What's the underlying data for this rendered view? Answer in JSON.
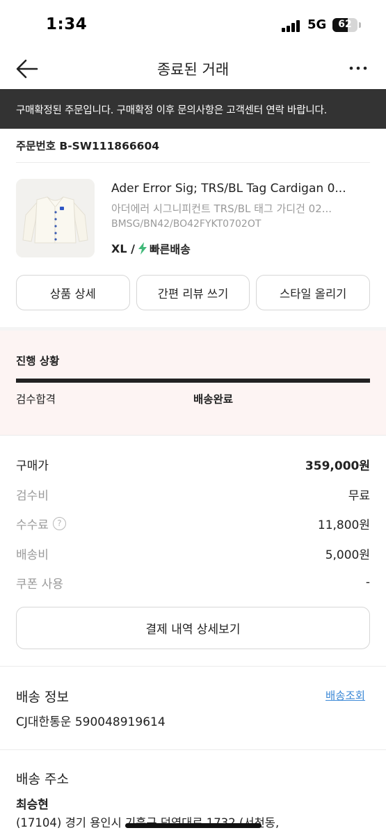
{
  "status_bar": {
    "time": "1:34",
    "network": "5G",
    "battery_level": "62"
  },
  "header": {
    "title": "종료된 거래",
    "back_icon": "arrow-left-icon",
    "more_icon": "more-dots-icon"
  },
  "notice": {
    "text": "구매확정된 주문입니다. 구매확정 이후 문의사항은 고객센터 연락 바랍니다."
  },
  "order": {
    "number_label": "주문번호 B-SW111866604"
  },
  "product": {
    "name_en": "Ader Error Sig; TRS/BL Tag Cardigan 0...",
    "name_ko": "아더에러 시그니피컨트 TRS/BL 태그 가디건 02...",
    "code": "BMSG/BN42/BO42FYKT0702OT",
    "size": "XL /",
    "delivery_type": "빠른배송",
    "delivery_icon": "lightning-bolt-icon",
    "accent_color": "#41b979"
  },
  "actions": {
    "detail_label": "상품 상세",
    "review_label": "간편 리뷰 쓰기",
    "style_label": "스타일 올리기"
  },
  "progress": {
    "title": "진행 상황",
    "steps": [
      "검수합격",
      "배송완료"
    ],
    "completed_fraction": 1.0,
    "background_color": "#fdf4f3"
  },
  "payment": {
    "rows": [
      {
        "label": "구매가",
        "value": "359,000원"
      },
      {
        "label": "검수비",
        "value": "무료"
      },
      {
        "label": "수수료",
        "value": "11,800원"
      },
      {
        "label": "배송비",
        "value": "5,000원"
      },
      {
        "label": "쿠폰 사용",
        "value": "-"
      }
    ],
    "help_icon": "question-circle-icon",
    "detail_button": "결제 내역 상세보기"
  },
  "shipping": {
    "title": "배송 정보",
    "track_link": "배송조회",
    "courier": "CJ대한통운 590048919614",
    "link_color": "#3b88d6"
  },
  "address": {
    "title": "배송 주소",
    "recipient": "최승현",
    "line1": "(17104) 경기 용인시 기흥구 덕영대로 1732 (서천동,"
  }
}
